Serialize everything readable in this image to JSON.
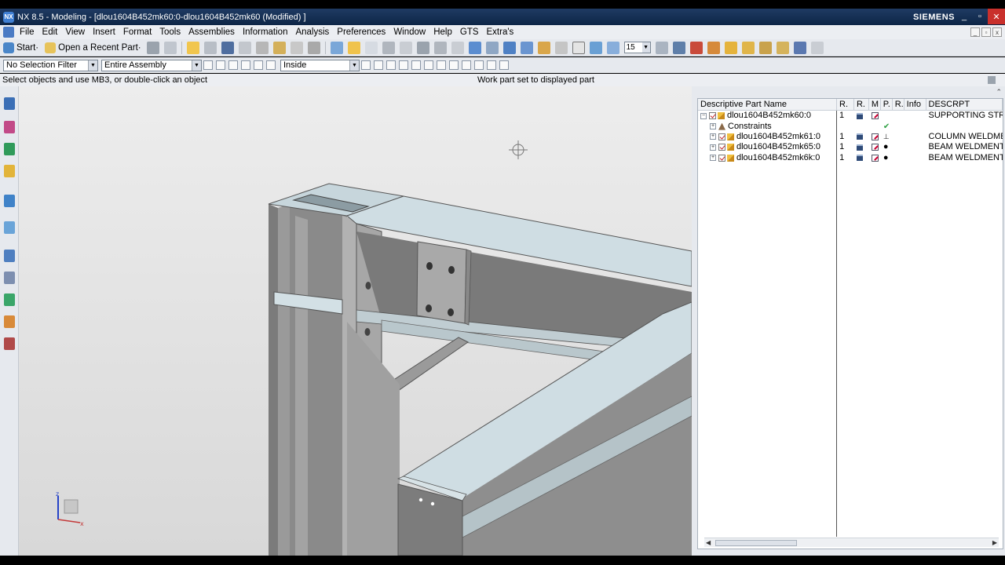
{
  "window": {
    "title": "NX 8.5 - Modeling - [dlou1604B452mk60:0-dlou1604B452mk60 (Modified) ]",
    "brand": "SIEMENS",
    "minimize": "_",
    "maximize": "▫",
    "close": "✕"
  },
  "menu": {
    "items": [
      "File",
      "Edit",
      "View",
      "Insert",
      "Format",
      "Tools",
      "Assemblies",
      "Information",
      "Analysis",
      "Preferences",
      "Window",
      "Help",
      "GTS",
      "Extra's"
    ]
  },
  "toolbar": {
    "start_label": "Start·",
    "recent_label": "Open a Recent Part·",
    "zoom_value": "15"
  },
  "filter_bar": {
    "selection_filter": "No Selection Filter",
    "assembly_scope": "Entire Assembly",
    "inside_mode": "Inside"
  },
  "status": {
    "prompt": "Select objects and use MB3, or double-click an object",
    "message": "Work part set to displayed part"
  },
  "navigator": {
    "columns": [
      "Descriptive Part Name",
      "R.",
      "R.",
      "M",
      "P.",
      "R.",
      "Info",
      "DESCRPT"
    ],
    "rows": [
      {
        "name": "dlou1604B452mk60:0",
        "r1": "1",
        "desc": "SUPPORTING STR",
        "type": "assembly",
        "p": ""
      },
      {
        "name": "Constraints",
        "r1": "",
        "desc": "",
        "type": "constraints",
        "p": "✔"
      },
      {
        "name": "dlou1604B452mk61:0",
        "r1": "1",
        "desc": "COLUMN WELDME",
        "type": "component",
        "p": "⊥"
      },
      {
        "name": "dlou1604B452mk65:0",
        "r1": "1",
        "desc": "BEAM WELDMENT",
        "type": "component",
        "p": "●"
      },
      {
        "name": "dlou1604B452mk6k:0",
        "r1": "1",
        "desc": "BEAM WELDMENT",
        "type": "component",
        "p": "●"
      }
    ]
  },
  "triad": {
    "z": "z",
    "x": "x"
  },
  "colors": {
    "titlebar": "#1f3b63",
    "steel_top": "#cfdde3",
    "steel_side": "#8e8e8e",
    "steel_dark": "#6f6f6f",
    "background": "#e3e3e3"
  }
}
